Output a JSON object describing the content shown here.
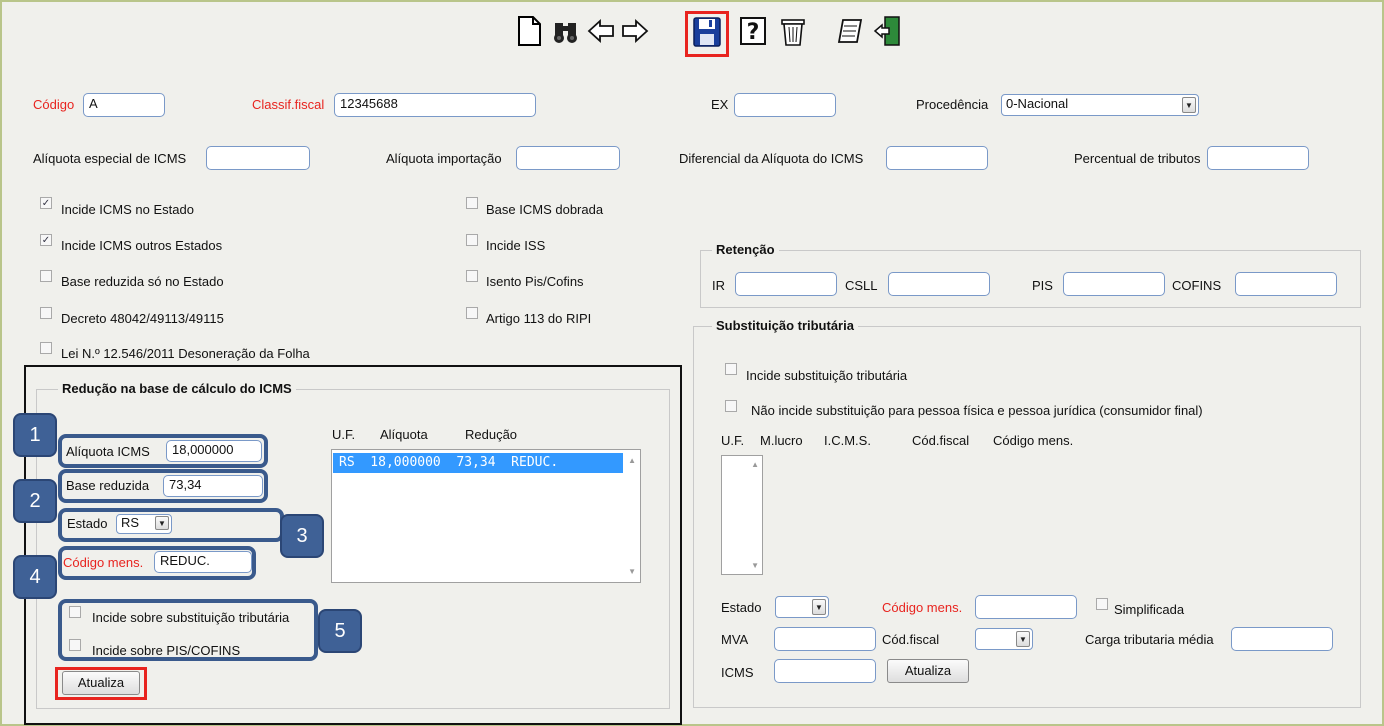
{
  "toolbar": {
    "new": "new-document-icon",
    "search": "binoculars-icon",
    "prev": "arrow-left-icon",
    "next": "arrow-right-icon",
    "save": "floppy-disk-icon",
    "help": "help-icon",
    "delete": "trash-icon",
    "edit": "notepad-icon",
    "exit": "exit-door-icon"
  },
  "header": {
    "codigo_label": "Código",
    "codigo_value": "A",
    "classif_label": "Classif.fiscal",
    "classif_value": "12345688",
    "ex_label": "EX",
    "ex_value": "",
    "procedencia_label": "Procedência",
    "procedencia_value": "0-Nacional",
    "aliq_esp_label": "Alíquota especial de ICMS",
    "aliq_imp_label": "Alíquota importação",
    "dif_aliq_label": "Diferencial da Alíquota do ICMS",
    "perc_trib_label": "Percentual de tributos"
  },
  "checks": {
    "incide_estado": "Incide ICMS no Estado",
    "incide_outros": "Incide ICMS outros Estados",
    "base_reduzida": "Base reduzida só no Estado",
    "decreto": "Decreto 48042/49113/49115",
    "lei": "Lei N.º 12.546/2011 Desoneração da Folha",
    "base_dobrada": "Base ICMS dobrada",
    "incide_iss": "Incide ISS",
    "isento_pis": "Isento Pis/Cofins",
    "artigo_113": "Artigo 113 do RIPI",
    "checked_mark": "✓"
  },
  "retencao": {
    "title": "Retenção",
    "ir": "IR",
    "csll": "CSLL",
    "pis": "PIS",
    "cofins": "COFINS"
  },
  "substituicao": {
    "title": "Substituição tributária",
    "incide": "Incide substituição tributária",
    "nao_incide": "Não incide substituição para pessoa física e pessoa jurídica (consumidor final)",
    "col_uf": "U.F.",
    "col_mlucro": "M.lucro",
    "col_icms": "I.C.M.S.",
    "col_codfiscal": "Cód.fiscal",
    "col_codmens": "Código mens.",
    "estado": "Estado",
    "codigo_mens": "Código mens.",
    "simplificada": "Simplificada",
    "mva": "MVA",
    "cod_fiscal": "Cód.fiscal",
    "carga_media": "Carga tributaria média",
    "icms": "ICMS",
    "atualiza": "Atualiza"
  },
  "reducao": {
    "title": "Redução na base de cálculo do ICMS",
    "aliquota_label": "Alíquota ICMS",
    "aliquota_value": "18,000000",
    "base_label": "Base reduzida",
    "base_value": "73,34",
    "estado_label": "Estado",
    "estado_value": "RS",
    "codmens_label": "Código mens.",
    "codmens_value": "REDUC.",
    "col_uf": "U.F.",
    "col_aliquota": "Alíquota",
    "col_reducao": "Redução",
    "list_row": "RS  18,000000  73,34  REDUC.",
    "incide_subst": "Incide sobre substituição tributária",
    "incide_pis": "Incide sobre PIS/COFINS",
    "atualiza": "Atualiza"
  },
  "badges": [
    "1",
    "2",
    "3",
    "4",
    "5"
  ],
  "colors": {
    "highlight_red": "#e8241f",
    "callout_blue": "#3a5a8c",
    "selected_row": "#3399ff"
  }
}
